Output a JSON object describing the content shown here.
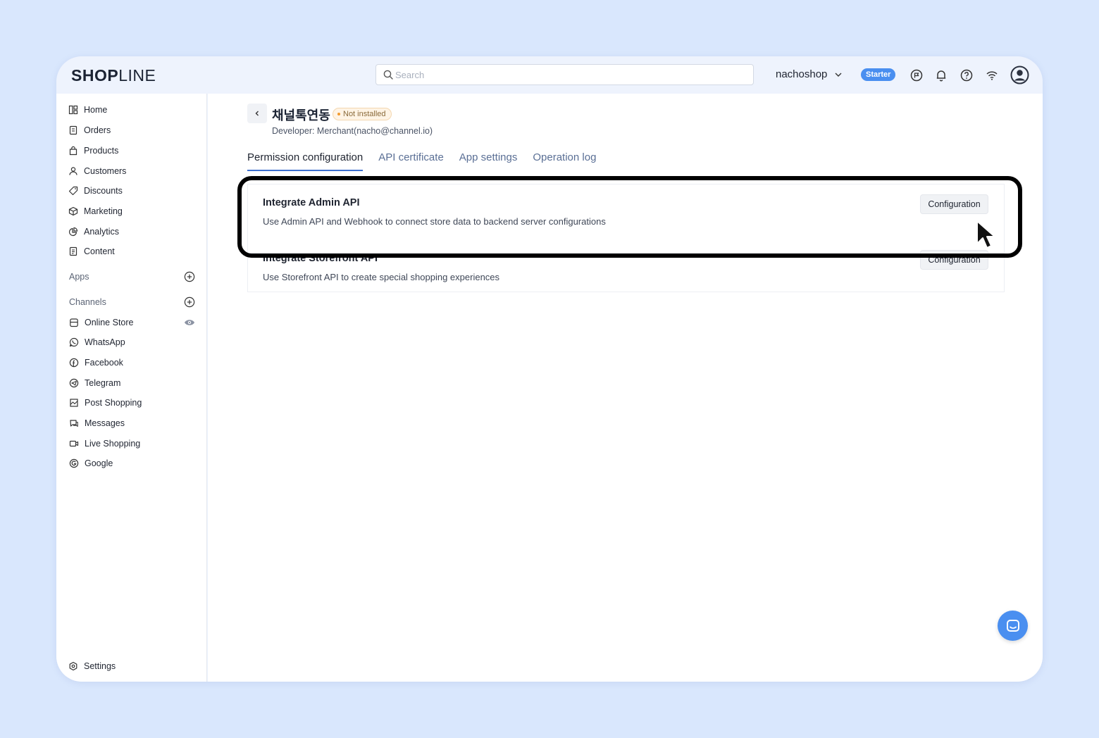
{
  "brand": {
    "logo_bold": "SHOP",
    "logo_light": "LINE"
  },
  "search": {
    "placeholder": "Search"
  },
  "header": {
    "store_name": "nachoshop",
    "plan_badge": "Starter"
  },
  "sidebar": {
    "items": [
      {
        "label": "Home",
        "icon": "home-icon"
      },
      {
        "label": "Orders",
        "icon": "orders-icon"
      },
      {
        "label": "Products",
        "icon": "products-icon"
      },
      {
        "label": "Customers",
        "icon": "customers-icon"
      },
      {
        "label": "Discounts",
        "icon": "tag-icon"
      },
      {
        "label": "Marketing",
        "icon": "cube-icon"
      },
      {
        "label": "Analytics",
        "icon": "pie-chart-icon"
      },
      {
        "label": "Content",
        "icon": "document-icon"
      }
    ],
    "apps_label": "Apps",
    "channels_label": "Channels",
    "channels": [
      {
        "label": "Online Store",
        "icon": "store-icon"
      },
      {
        "label": "WhatsApp",
        "icon": "whatsapp-icon"
      },
      {
        "label": "Facebook",
        "icon": "facebook-icon"
      },
      {
        "label": "Telegram",
        "icon": "telegram-icon"
      },
      {
        "label": "Post Shopping",
        "icon": "post-shopping-icon"
      },
      {
        "label": "Messages",
        "icon": "messages-icon"
      },
      {
        "label": "Live Shopping",
        "icon": "video-icon"
      },
      {
        "label": "Google",
        "icon": "google-icon"
      }
    ],
    "settings_label": "Settings"
  },
  "app": {
    "title": "채널톡연동",
    "status": "Not installed",
    "developer": "Developer:  Merchant(nacho@channel.io)"
  },
  "tabs": [
    {
      "label": "Permission configuration",
      "active": true
    },
    {
      "label": "API certificate",
      "active": false
    },
    {
      "label": "App settings",
      "active": false
    },
    {
      "label": "Operation log",
      "active": false
    }
  ],
  "integrations": [
    {
      "title": "Integrate Admin API",
      "description": "Use Admin API and Webhook to connect store data to backend server configurations",
      "button": "Configuration"
    },
    {
      "title": "Integrate Storefront API",
      "description": "Use Storefront API to create special shopping experiences",
      "button": "Configuration"
    }
  ],
  "colors": {
    "accent": "#3c6fd0",
    "badge": "#4a8ff0",
    "background": "#d9e7fd"
  }
}
